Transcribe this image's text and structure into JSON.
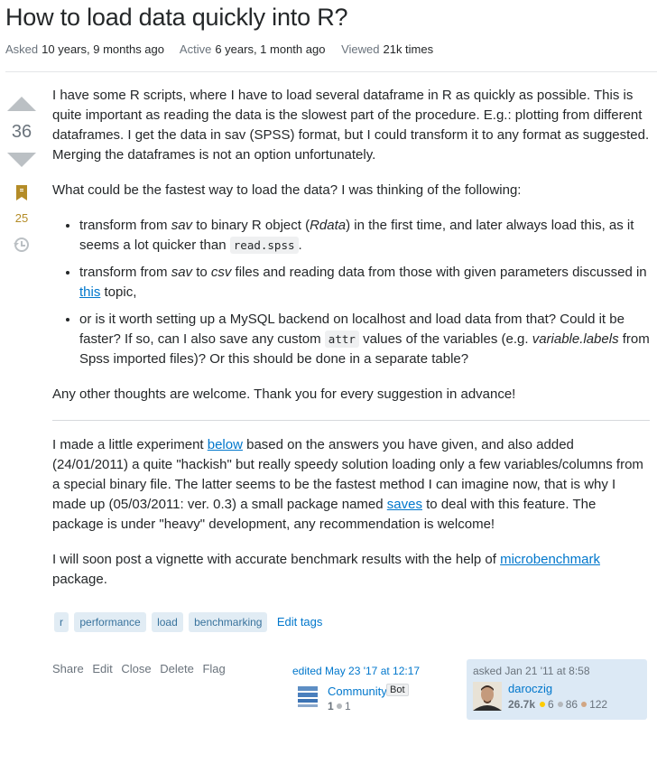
{
  "question": {
    "title": "How to load data quickly into R?",
    "meta": [
      {
        "label": "Asked",
        "value": "10 years, 9 months ago"
      },
      {
        "label": "Active",
        "value": "6 years, 1 month ago"
      },
      {
        "label": "Viewed",
        "value": "21k times"
      }
    ]
  },
  "votes": {
    "score": "36",
    "favorites": "25",
    "upvote_icon": "triangle-up-icon",
    "downvote_icon": "triangle-down-icon",
    "bookmark_icon": "bookmark-icon",
    "history_icon": "history-icon"
  },
  "body": {
    "p1": "I have some R scripts, where I have to load several dataframe in R as quickly as possible. This is quite important as reading the data is the slowest part of the procedure. E.g.: plotting from different dataframes. I get the data in sav (SPSS) format, but I could transform it to any format as suggested. Merging the dataframes is not an option unfortunately.",
    "p2": "What could be the fastest way to load the data? I was thinking of the following:",
    "li1": {
      "a": "transform from ",
      "b": "sav",
      "c": " to binary R object (",
      "d": "Rdata",
      "e": ") in the first time, and later always load this, as it seems a lot quicker than ",
      "code": "read.spss",
      "f": "."
    },
    "li2": {
      "a": "transform from ",
      "b": "sav",
      "c": " to ",
      "d": "csv",
      "e": " files and reading data from those with given parameters discussed in ",
      "link": "this",
      "f": " topic,"
    },
    "li3": {
      "a": "or is it worth setting up a MySQL backend on localhost and load data from that? Could it be faster? If so, can I also save any custom ",
      "code": "attr",
      "b": " values of the variables (e.g. ",
      "c": "variable.labels",
      "d": " from Spss imported files)? Or this should be done in a separate table?"
    },
    "p3": "Any other thoughts are welcome. Thank you for every suggestion in advance!",
    "p4": {
      "a": "I made a little experiment ",
      "link1": "below",
      "b": " based on the answers you have given, and also added (24/01/2011) a quite \"hackish\" but really speedy solution loading only a few variables/columns from a special binary file. The latter seems to be the fastest method I can imagine now, that is why I made up (05/03/2011: ver. 0.3) a small package named ",
      "link2": "saves",
      "c": " to deal with this feature. The package is under \"heavy\" development, any recommendation is welcome!"
    },
    "p5": {
      "a": "I will soon post a vignette with accurate benchmark results with the help of ",
      "link": "microbenchmark",
      "b": " package."
    }
  },
  "tags": [
    "r",
    "performance",
    "load",
    "benchmarking"
  ],
  "edit_tags_label": "Edit tags",
  "menu": [
    "Share",
    "Edit",
    "Close",
    "Delete",
    "Flag"
  ],
  "edited": {
    "when": "edited May 23 '17 at 12:17",
    "user": "Community",
    "badge": "Bot",
    "rep": "1",
    "silver": "1"
  },
  "asked": {
    "when": "asked Jan 21 '11 at 8:58",
    "user": "daroczig",
    "rep": "26.7k",
    "gold": "6",
    "silver": "86",
    "bronze": "122"
  },
  "colors": {
    "link": "#0077cc",
    "tag_bg": "#e1ecf4",
    "tag_text": "#39739d",
    "card_bg": "#dce9f5",
    "favorite": "#b48c27"
  }
}
